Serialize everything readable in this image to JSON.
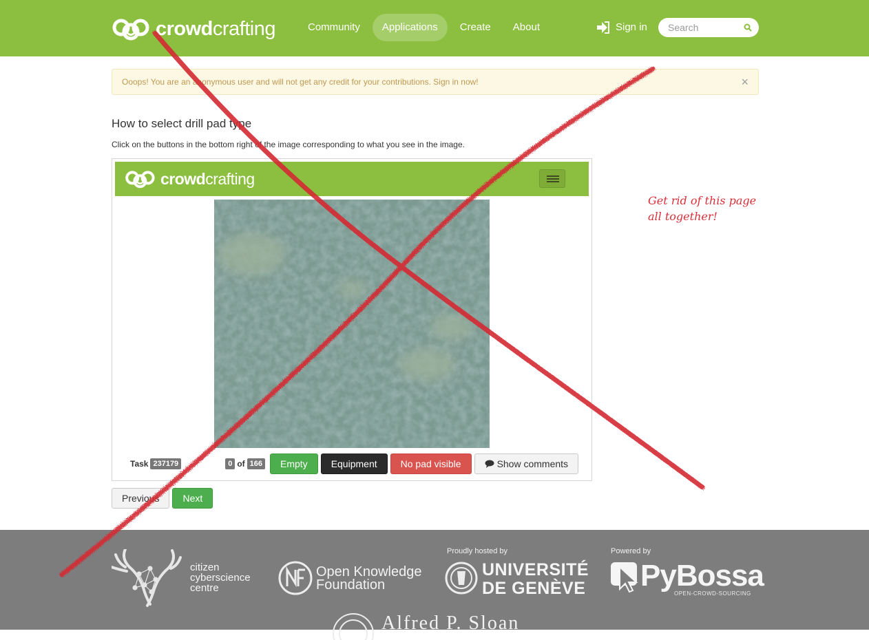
{
  "header": {
    "brand_strong": "crowd",
    "brand_rest": "crafting",
    "nav": [
      {
        "label": "Community"
      },
      {
        "label": "Applications"
      },
      {
        "label": "Create"
      },
      {
        "label": "About"
      }
    ],
    "active_nav": "Applications",
    "signin_label": "Sign in",
    "search_placeholder": "Search"
  },
  "alert": {
    "text": "Ooops! You are an anonymous user and will not get any credit for your contributions. Sign in now!",
    "close": "×"
  },
  "task": {
    "title": "How to select drill pad type",
    "description": "Click on the buttons in the bottom right of the image corresponding to what you see in the image.",
    "inner_brand_strong": "crowd",
    "inner_brand_rest": "crafting",
    "task_label": "Task",
    "task_id": "237179",
    "done_count": "0",
    "of_label": "of",
    "total_count": "166",
    "buttons": {
      "empty": "Empty",
      "equipment": "Equipment",
      "no_pad": "No pad visible",
      "comments": "Show comments"
    },
    "previous": "Previous",
    "next": "Next"
  },
  "footer": {
    "ccc_line1": "citizen",
    "ccc_line2": "cyberscience",
    "ccc_line3": "centre",
    "okf_line1": "Open Knowledge",
    "okf_line2": "Foundation",
    "hosted_label": "Proudly hosted by",
    "unige_line1": "UNIVERSITÉ",
    "unige_line2": "DE GENÈVE",
    "powered_label": "Powered by",
    "pybossa_name": "PyBossa",
    "pybossa_tagline": "OPEN-CROWD-SOURCING",
    "sloan_name": "Alfred P. Sloan"
  },
  "annotation": {
    "line1": "Get rid of this page",
    "line2": "all together!"
  },
  "colors": {
    "brand_green": "#8cbf3f",
    "annotation_red": "#d8303a",
    "footer_grey": "#7d7d7d"
  }
}
